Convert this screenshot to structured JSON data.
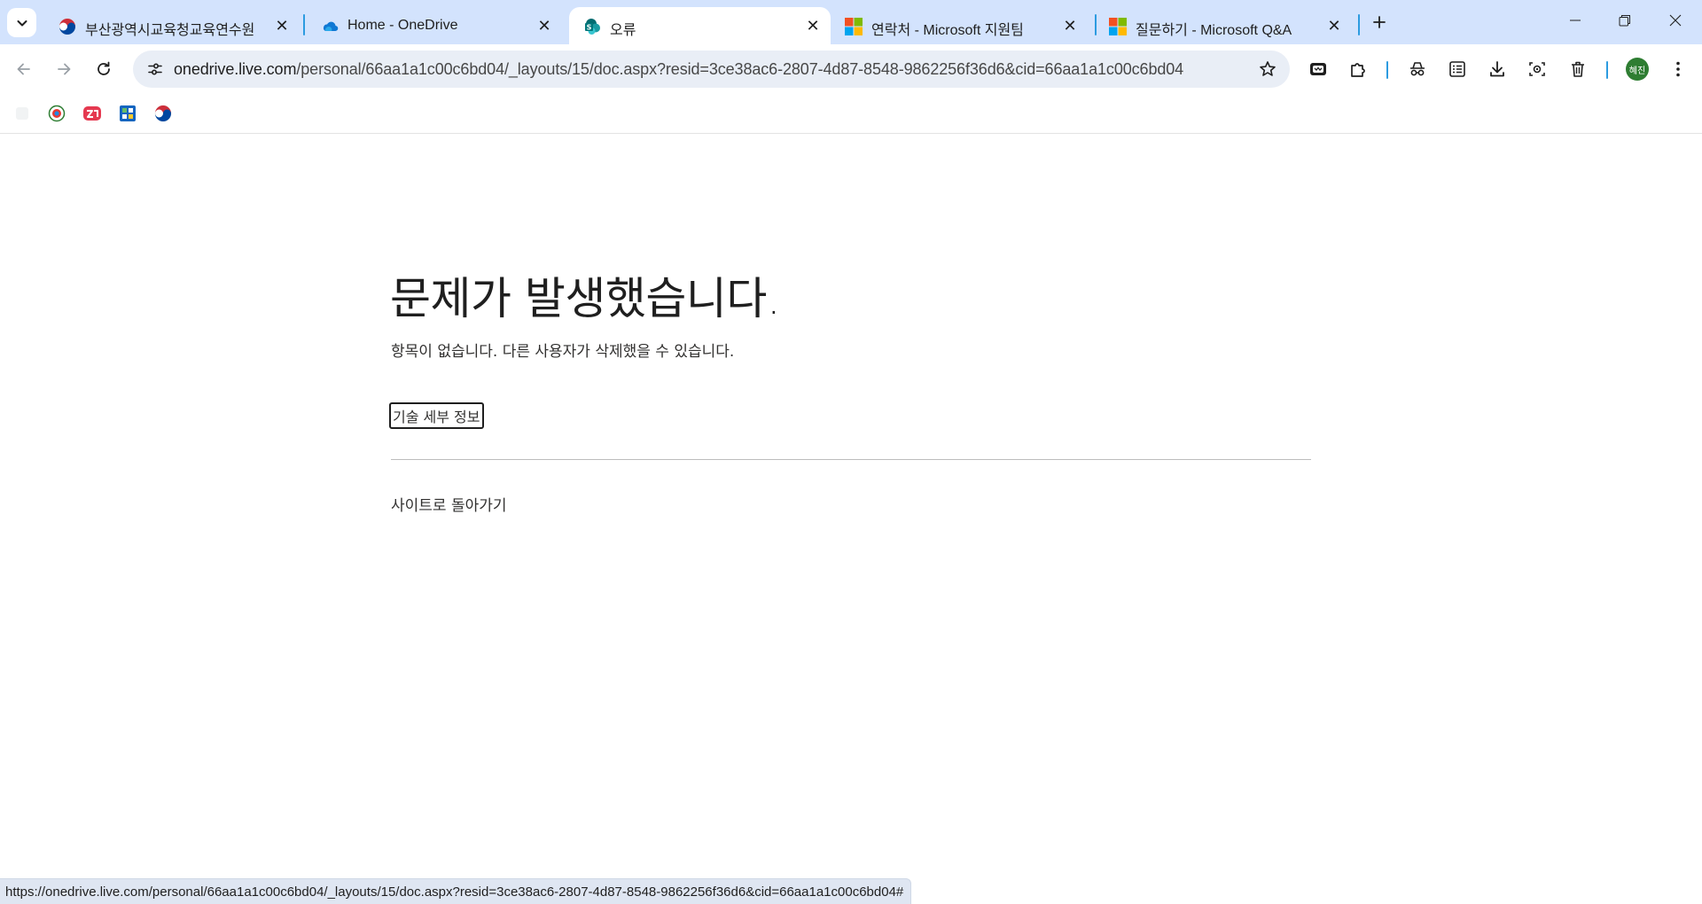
{
  "browser": {
    "tabs": [
      {
        "title": "부산광역시교육청교육연수원",
        "favicon": "korea-taegeuk-icon",
        "active": false
      },
      {
        "title": "Home - OneDrive",
        "favicon": "onedrive-cloud-icon",
        "active": false
      },
      {
        "title": "오류",
        "favicon": "sharepoint-icon",
        "active": true
      },
      {
        "title": "연락처 - Microsoft 지원팀",
        "favicon": "microsoft-logo-icon",
        "active": false
      },
      {
        "title": "질문하기 - Microsoft Q&A",
        "favicon": "microsoft-logo-icon",
        "active": false
      }
    ],
    "close_glyph": "✕",
    "address": {
      "host": "onedrive.live.com",
      "path": "/personal/66aa1a1c00c6bd04/_layouts/15/doc.aspx?resid=3ce38ac6-2807-4d87-8548-9862256f36d6&cid=66aa1a1c00c6bd04"
    },
    "profile_initials": "혜진",
    "colors": {
      "tabstrip": "#d3e3fd",
      "omnibox": "#e9eef6",
      "separator": "#2c9be0",
      "profile": "#2e7d32"
    }
  },
  "page": {
    "title": "문제가 발생했습니다.",
    "description": "항목이 없습니다. 다른 사용자가 삭제했을 수 있습니다.",
    "tech_details_link": "기술 세부 정보",
    "back_link": "사이트로 돌아가기"
  },
  "status_bar": {
    "url": "https://onedrive.live.com/personal/66aa1a1c00c6bd04/_layouts/15/doc.aspx?resid=3ce38ac6-2807-4d87-8548-9862256f36d6&cid=66aa1a1c00c6bd04#"
  }
}
